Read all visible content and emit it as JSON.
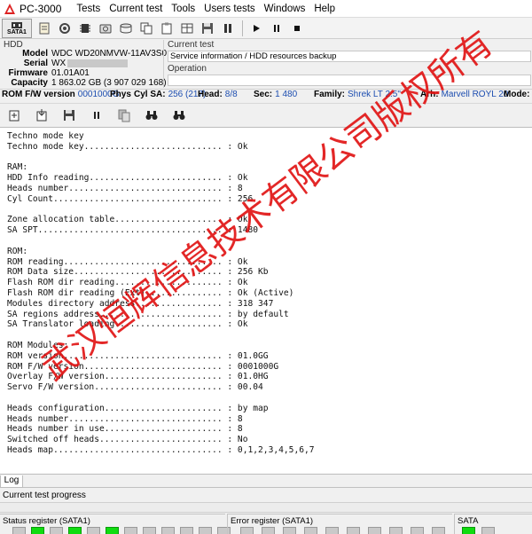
{
  "window": {
    "title": "PC-3000",
    "menu": [
      "Tests",
      "Current test",
      "Tools",
      "Users tests",
      "Windows",
      "Help"
    ]
  },
  "toolbar": {
    "sata_label": "SATA1"
  },
  "hdd": {
    "group_label": "HDD",
    "model_label": "Model",
    "model": "WDC WD20NMVW-11AV3S0",
    "serial_label": "Serial",
    "serial": "WX",
    "firmware_label": "Firmware",
    "firmware": "01.01A01",
    "capacity_label": "Capacity",
    "capacity": "1 863.02 GB (3 907 029 168)"
  },
  "current_test": {
    "label": "Current test",
    "value": "Service information / HDD resources backup",
    "operation_label": "Operation",
    "operation_value": ""
  },
  "infobar": {
    "rom_fw_label": "ROM F/W version",
    "rom_fw": "0001000G",
    "phys_label": "Phys",
    "cyl_sa_label": "Cyl SA:",
    "cyl_sa": "256 (217)",
    "head_label": "Head:",
    "head": "8/8",
    "sec_label": "Sec:",
    "sec": "1 480",
    "family_label": "Family:",
    "family": "Shrek LT 2.5\"",
    "arh_label": "Arh:",
    "arh": "Marvell ROYL 20",
    "mode_label": "Mode: M"
  },
  "log": {
    "lines": [
      "Techno mode key",
      "Techno mode key........................... : Ok",
      "",
      "RAM:",
      "HDD Info reading.......................... : Ok",
      "Heads number.............................. : 8",
      "Cyl Count................................. : 256",
      "",
      "Zone allocation table..................... : Ok",
      "SA SPT.................................... : 1480",
      "",
      "ROM:",
      "ROM reading............................... : Ok",
      "ROM Data size............................. : 256 Kb",
      "Flash ROM dir reading..................... : Ok",
      "Flash ROM dir reading (Ext)............... : Ok (Active)",
      "Modules directory address................. : 318 347",
      "SA regions address........................ : by default",
      "SA Translator loading..................... : Ok",
      "",
      "ROM Modules:",
      "ROM version............................... : 01.0GG",
      "ROM F/W version........................... : 0001000G",
      "Overlay F/W version....................... : 01.0HG",
      "Servo F/W version......................... : 00.04",
      "",
      "Heads configuration....................... : by map",
      "Heads number.............................. : 8",
      "Heads number in use....................... : 8",
      "Switched off heads........................ : No",
      "Heads map................................. : 0,1,2,3,4,5,6,7"
    ]
  },
  "watermark": "武汉恒辉信息技术有限公司版权所有",
  "tabs": {
    "log": "Log"
  },
  "progress": {
    "label": "Current test progress"
  },
  "status": {
    "status_register_label": "Status register (SATA1)",
    "error_register_label": "Error register (SATA1)",
    "sata_label": "SATA",
    "status_leds": [
      false,
      true,
      false,
      true,
      false,
      true,
      false,
      false,
      false,
      false,
      false,
      false
    ],
    "error_leds": [
      false,
      false,
      false,
      false,
      false,
      false,
      false,
      false,
      false,
      false
    ],
    "sata_leds": [
      true,
      false
    ]
  },
  "colors": {
    "led_on": "#10dc10",
    "value_blue": "#1c4db0",
    "watermark_red": "#e01010"
  }
}
